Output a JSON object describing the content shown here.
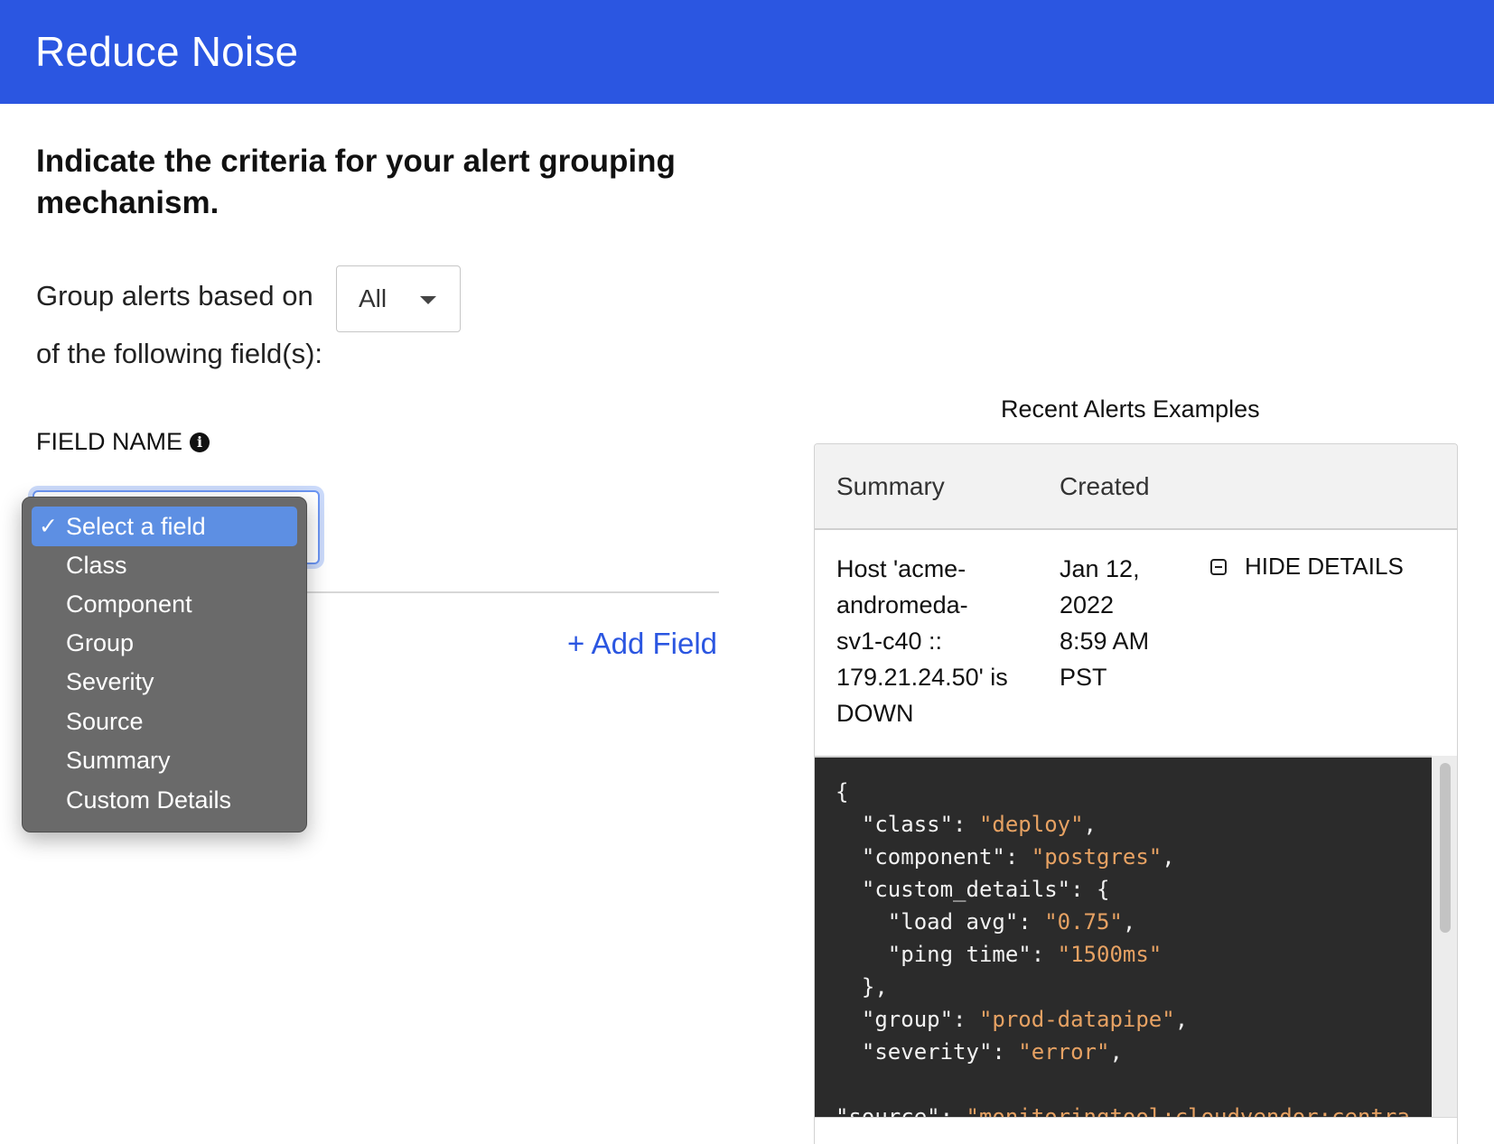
{
  "header": {
    "title": "Reduce Noise"
  },
  "heading": "Indicate the criteria for your alert grouping mechanism.",
  "group_by": {
    "label": "Group alerts based on",
    "selected": "All",
    "suffix": "of the following field(s):"
  },
  "field_name": {
    "label": "FIELD NAME",
    "info_icon": "info-icon"
  },
  "field_dropdown": {
    "options": [
      "Select a field",
      "Class",
      "Component",
      "Group",
      "Severity",
      "Source",
      "Summary",
      "Custom Details"
    ],
    "selected_index": 0
  },
  "add_field_label": "+ Add Field",
  "recent_alerts": {
    "title": "Recent Alerts Examples",
    "columns": [
      "Summary",
      "Created"
    ],
    "row": {
      "summary_lines": [
        "Host 'acme-",
        "andromeda-",
        "sv1-c40 ::",
        "179.21.24.50' is",
        "DOWN"
      ],
      "created_lines": [
        "Jan 12,",
        "2022",
        "8:59 AM",
        "PST"
      ],
      "action": "HIDE DETAILS"
    },
    "details_json": [
      [
        {
          "t": "k",
          "v": "{"
        }
      ],
      [
        {
          "t": "k",
          "v": "  \"class\": "
        },
        {
          "t": "s",
          "v": "\"deploy\""
        },
        {
          "t": "k",
          "v": ","
        }
      ],
      [
        {
          "t": "k",
          "v": "  \"component\": "
        },
        {
          "t": "s",
          "v": "\"postgres\""
        },
        {
          "t": "k",
          "v": ","
        }
      ],
      [
        {
          "t": "k",
          "v": "  \"custom_details\": {"
        }
      ],
      [
        {
          "t": "k",
          "v": "    \"load avg\": "
        },
        {
          "t": "s",
          "v": "\"0.75\""
        },
        {
          "t": "k",
          "v": ","
        }
      ],
      [
        {
          "t": "k",
          "v": "    \"ping time\": "
        },
        {
          "t": "s",
          "v": "\"1500ms\""
        }
      ],
      [
        {
          "t": "k",
          "v": "  },"
        }
      ],
      [
        {
          "t": "k",
          "v": "  \"group\": "
        },
        {
          "t": "s",
          "v": "\"prod-datapipe\""
        },
        {
          "t": "k",
          "v": ","
        }
      ],
      [
        {
          "t": "k",
          "v": "  \"severity\": "
        },
        {
          "t": "s",
          "v": "\"error\""
        },
        {
          "t": "k",
          "v": ","
        }
      ],
      [
        {
          "t": "k",
          "v": ""
        }
      ],
      [
        {
          "t": "k",
          "v": "\"source\": "
        },
        {
          "t": "s",
          "v": "\"monitoringtool:cloudvendor:centra"
        }
      ]
    ]
  },
  "colors": {
    "header_bg": "#2b56e1",
    "accent": "#2b56e1",
    "dropdown_bg": "#6a6a6a",
    "dropdown_selected": "#5d8fe3",
    "code_bg": "#2b2b2b",
    "code_string": "#e7a263"
  }
}
